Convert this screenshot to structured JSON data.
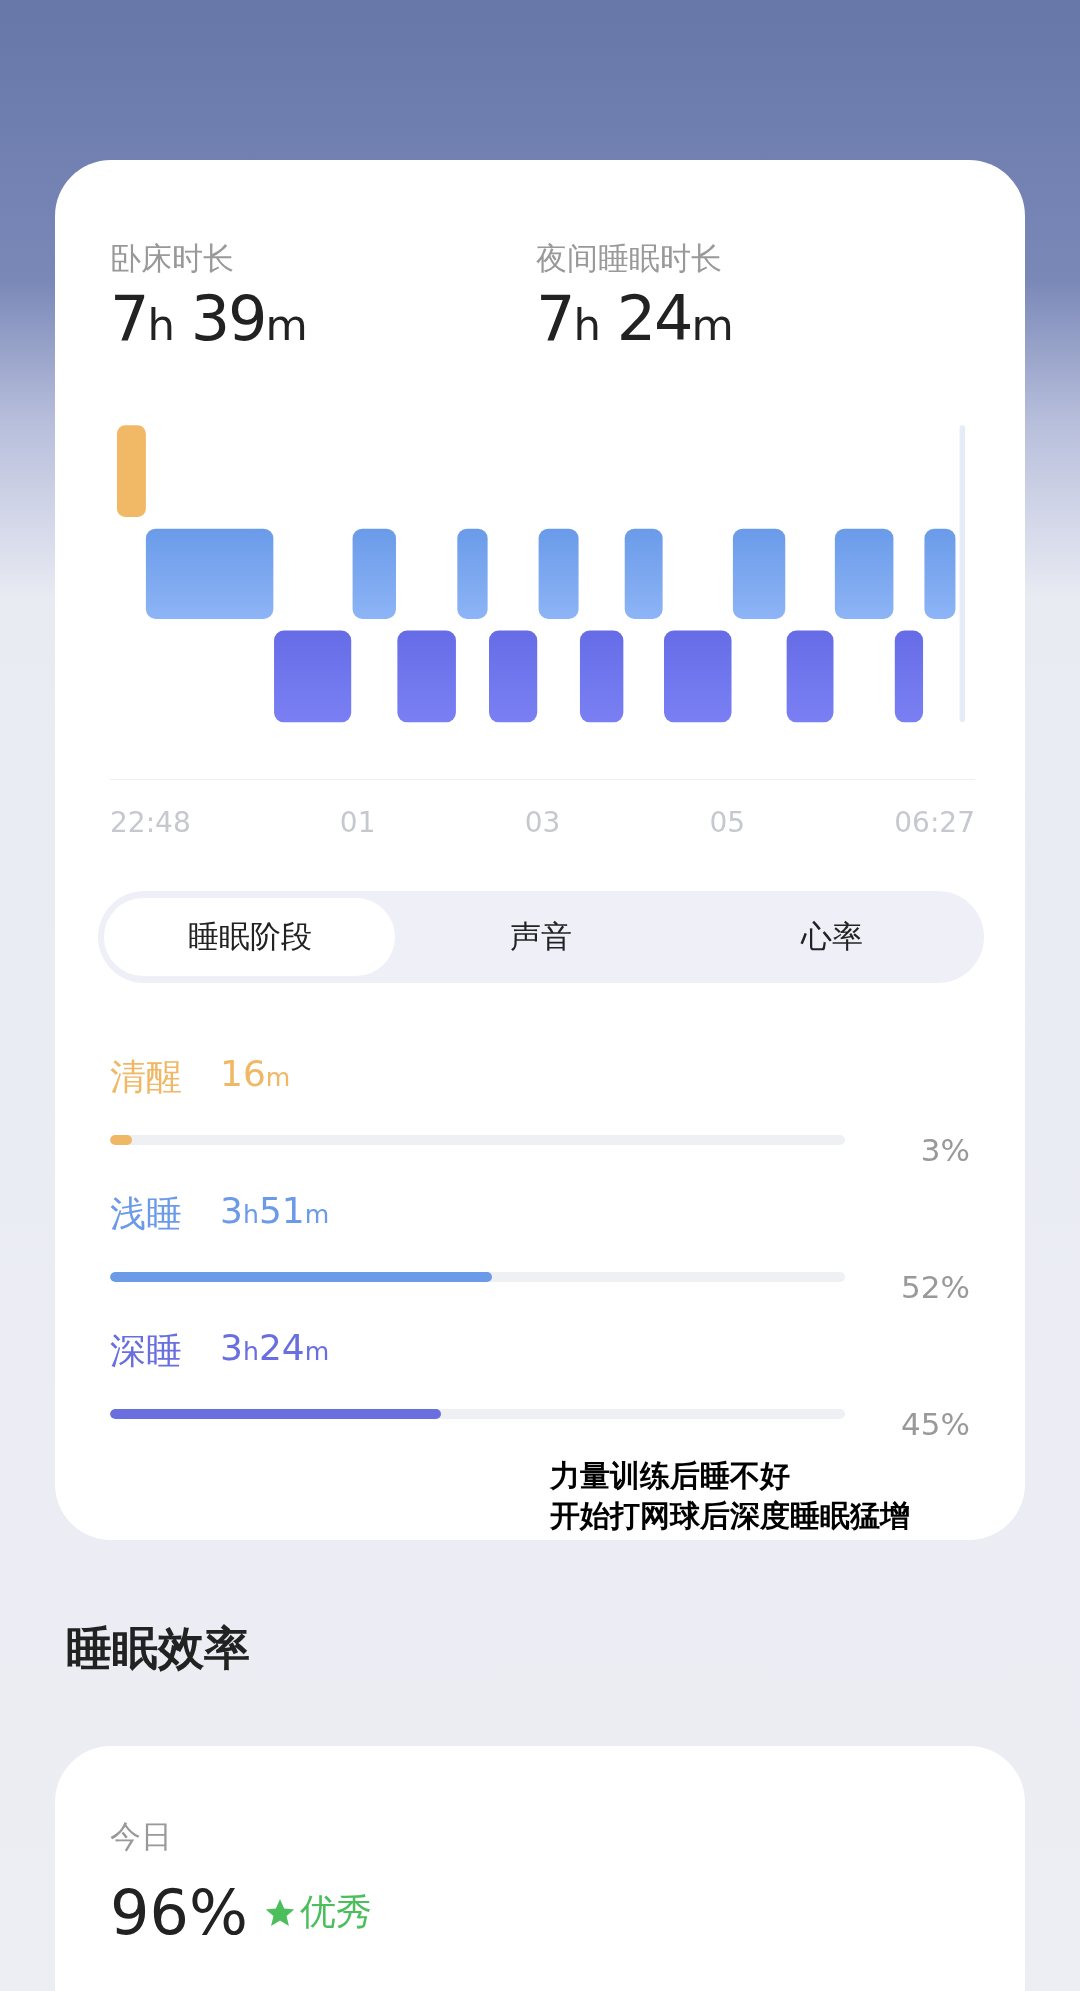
{
  "summary": [
    {
      "label": "卧床时长",
      "value": "7h 39m"
    },
    {
      "label": "夜间睡眠时长",
      "value": "7h 24m"
    }
  ],
  "timeline": {
    "axis_labels": [
      "22:48",
      "01",
      "03",
      "05",
      "06:27"
    ]
  },
  "tabs": [
    {
      "label": "睡眠阶段",
      "selected": true
    },
    {
      "label": "声音",
      "selected": false
    },
    {
      "label": "心率",
      "selected": false
    }
  ],
  "stages": [
    {
      "name": "清醒",
      "duration": "16m",
      "level": 0.03,
      "percent": "3%",
      "color": "#f0b865"
    },
    {
      "name": "浅睡",
      "duration": "3h51m",
      "level": 0.52,
      "percent": "52%",
      "color": "#6b9be8"
    },
    {
      "name": "深睡",
      "duration": "3h24m",
      "level": 0.45,
      "percent": "45%",
      "color": "#6a6fe0"
    }
  ],
  "annotation": [
    "力量训练后睡不好",
    "开始打网球后深度睡眠猛增"
  ],
  "efficiency": {
    "heading": "睡眠效率",
    "label": "今日",
    "value": "96%",
    "rating": "优秀"
  }
}
